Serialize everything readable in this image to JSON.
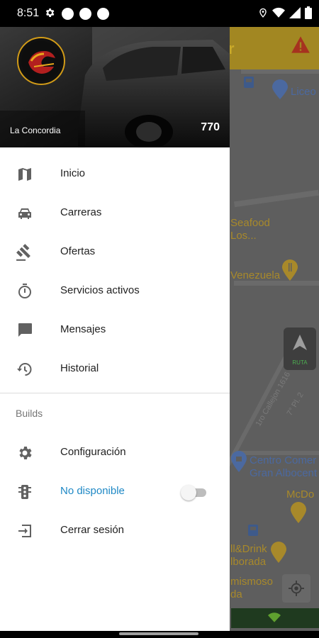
{
  "status_bar": {
    "time": "8:51",
    "icons": [
      "settings-icon",
      "notification-dot",
      "notification-dot",
      "notification-dot",
      "location-icon",
      "wifi-icon",
      "signal-icon",
      "battery-icon"
    ]
  },
  "map": {
    "title_fragment": "r",
    "labels": {
      "liceo": "Liceo",
      "seafood": "Seafood\nLos...",
      "venezuela": "Venezuela",
      "calle1": "1ro Callejon 1616",
      "calle2": "7° Pl. 2",
      "centro": "Centro Comer\nGran Albocent",
      "mcdo": "McDo",
      "grill": "ll&Drink\nlborada",
      "mismoso": "mismoso\nda"
    },
    "ruta_label": "RUTA",
    "accent": "#f2c230"
  },
  "drawer": {
    "header": {
      "company": "La Concordia",
      "count": "770"
    },
    "items": [
      {
        "label": "Inicio",
        "icon": "map-icon"
      },
      {
        "label": "Carreras",
        "icon": "car-icon"
      },
      {
        "label": "Ofertas",
        "icon": "gavel-icon"
      },
      {
        "label": "Servicios activos",
        "icon": "timer-icon"
      },
      {
        "label": "Mensajes",
        "icon": "message-icon"
      },
      {
        "label": "Historial",
        "icon": "history-icon"
      }
    ],
    "section_title": "Builds",
    "settings_items": [
      {
        "label": "Configuración",
        "icon": "gear-icon"
      },
      {
        "label": "No disponible",
        "icon": "traffic-light-icon",
        "toggle": false
      },
      {
        "label": "Cerrar sesión",
        "icon": "logout-icon"
      }
    ],
    "colors": {
      "status_text": "#1e88c5",
      "icon_gray": "#616161"
    }
  }
}
